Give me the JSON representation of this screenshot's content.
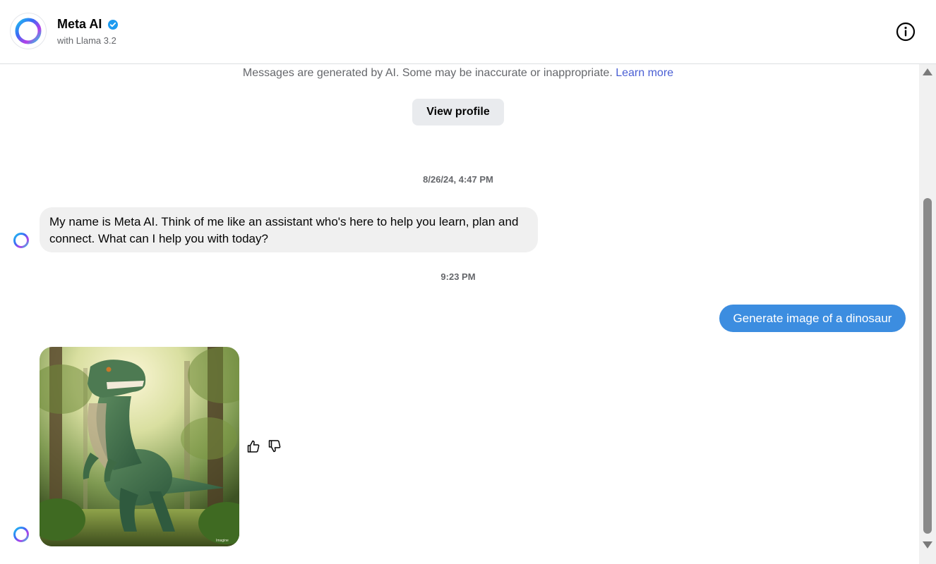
{
  "header": {
    "title": "Meta AI",
    "subtitle": "with Llama 3.2",
    "verified_icon": "verified-badge-icon",
    "info_icon": "info-icon"
  },
  "chat": {
    "disclaimer_text": "Messages are generated by AI. Some may be inaccurate or inappropriate.",
    "learn_more": "Learn more",
    "view_profile": "View profile",
    "messages": [
      {
        "type": "timestamp",
        "text": "8/26/24, 4:47 PM"
      },
      {
        "type": "bot",
        "text": "My name is Meta AI. Think of me like an assistant who's here to help you learn, plan and connect. What can I help you with today?"
      },
      {
        "type": "timestamp",
        "text": "9:23 PM"
      },
      {
        "type": "user",
        "text": "Generate image of a dinosaur"
      },
      {
        "type": "bot-image",
        "image": "generated-dinosaur-image"
      }
    ],
    "reactions": [
      "thumbs-up-icon",
      "thumbs-down-icon"
    ]
  },
  "colors": {
    "user_bubble": "#3c8de0",
    "bot_bubble": "#f0f0f0",
    "link": "#4a5fd4",
    "verified": "#1d9bf0"
  }
}
